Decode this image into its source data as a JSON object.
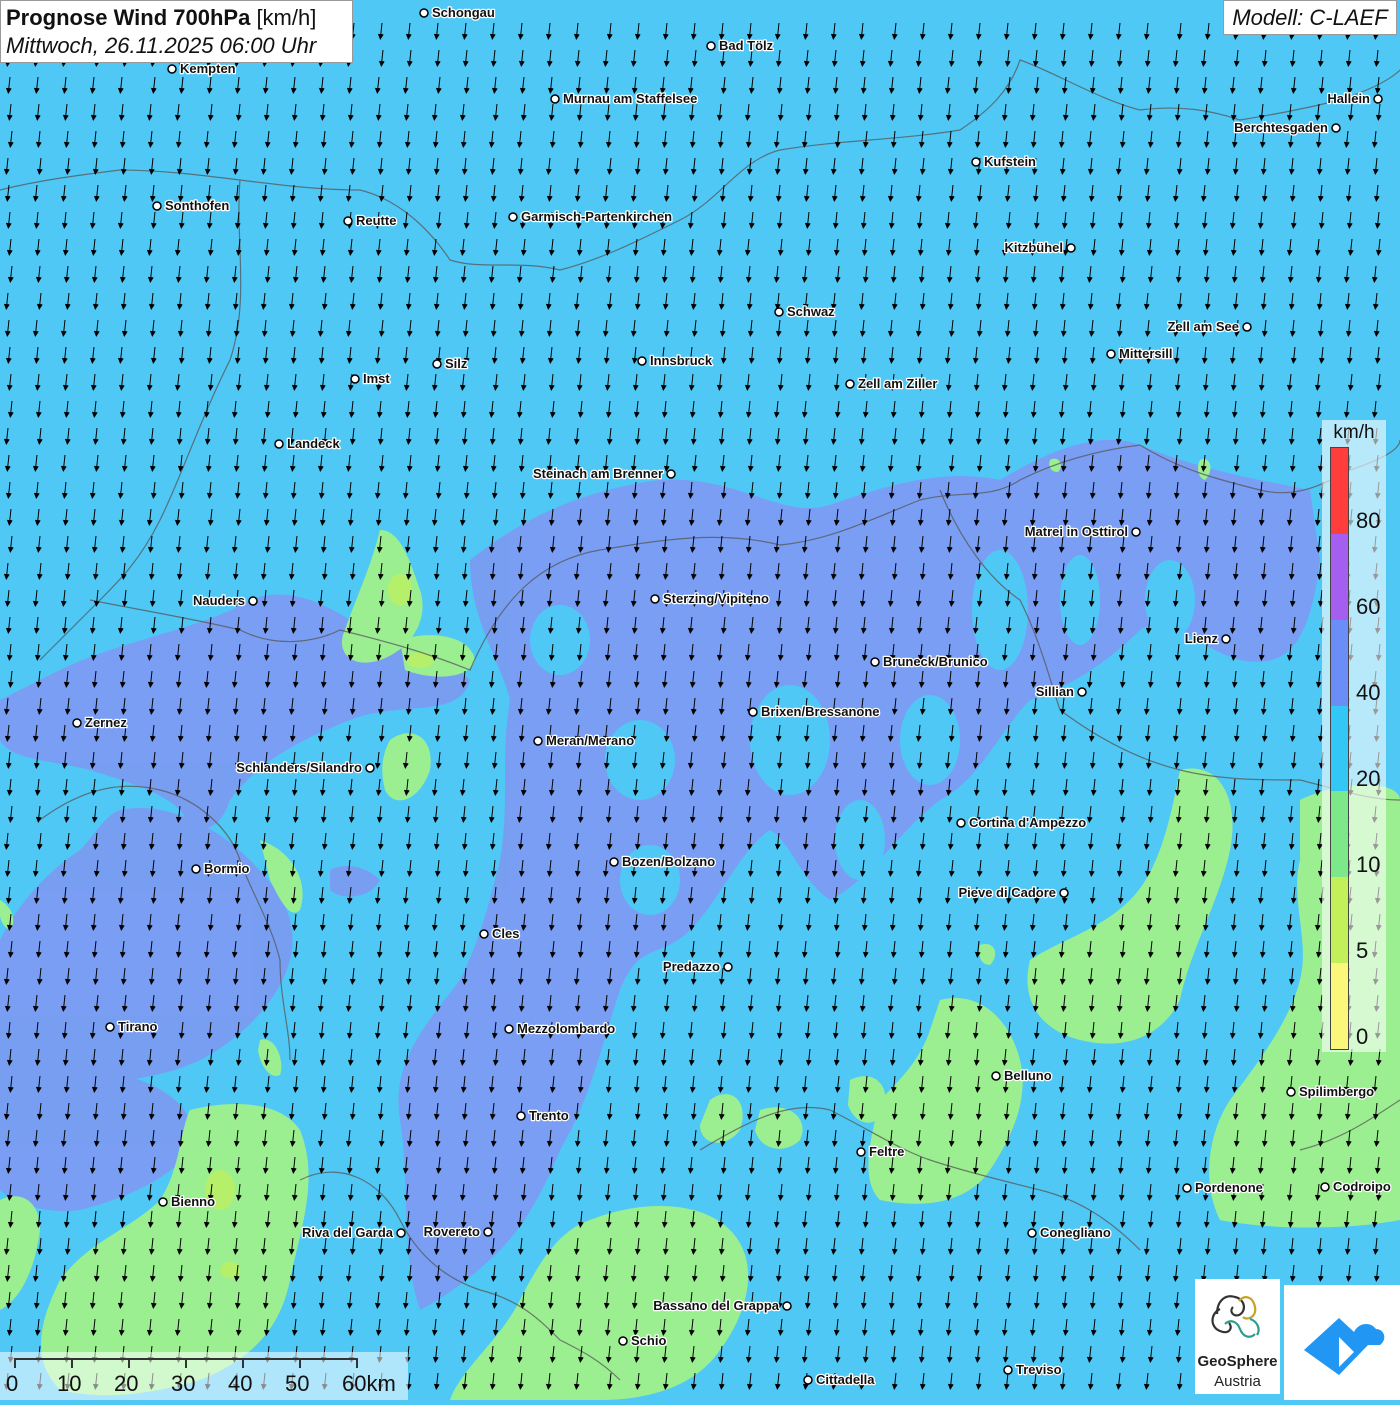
{
  "title": {
    "bold": "Prognose Wind 700hPa",
    "unit": "[km/h]",
    "date": "Mittwoch, 26.11.2025 06:00 Uhr"
  },
  "model": "Modell: C-LAEF",
  "legend": {
    "unit": "km/h",
    "ticks": [
      "80",
      "60",
      "40",
      "20",
      "10",
      "5",
      "0"
    ],
    "colors": [
      "#ff3d3d",
      "#a45ff0",
      "#6b8df7",
      "#33c7f5",
      "#7de88a",
      "#c2f059",
      "#fbf77a"
    ]
  },
  "scale": {
    "labels": [
      "0",
      "10",
      "20",
      "30",
      "40",
      "50",
      "60km"
    ]
  },
  "logo": {
    "name": "GeoSphere",
    "sub": "Austria"
  },
  "colors": {
    "background": "#4fc8f5",
    "zone_40_60": "#7b9cf2",
    "zone_5_20": "#9bef90"
  },
  "wind_direction": "from north (arrows pointing south-southwest)",
  "cities": [
    {
      "name": "Schongau"
    },
    {
      "name": "Bad Tölz"
    },
    {
      "name": "Kempten"
    },
    {
      "name": "Hallein"
    },
    {
      "name": "Murnau am Staffelsee"
    },
    {
      "name": "Berchtesgaden"
    },
    {
      "name": "Kufstein"
    },
    {
      "name": "Sonthofen"
    },
    {
      "name": "Reutte"
    },
    {
      "name": "Garmisch-Partenkirchen"
    },
    {
      "name": "Kitzbühel"
    },
    {
      "name": "Schwaz"
    },
    {
      "name": "Zell am See"
    },
    {
      "name": "Mittersill"
    },
    {
      "name": "Silz"
    },
    {
      "name": "Innsbruck"
    },
    {
      "name": "Imst"
    },
    {
      "name": "Zell am Ziller"
    },
    {
      "name": "Landeck"
    },
    {
      "name": "Steinach am Brenner"
    },
    {
      "name": "Matrei in Osttirol"
    },
    {
      "name": "Nauders"
    },
    {
      "name": "Sterzing/Vipiteno"
    },
    {
      "name": "Lienz"
    },
    {
      "name": "Bruneck/Brunico"
    },
    {
      "name": "Sillian"
    },
    {
      "name": "Brixen/Bressanone"
    },
    {
      "name": "Zernez"
    },
    {
      "name": "Meran/Merano"
    },
    {
      "name": "Schlanders/Silandro"
    },
    {
      "name": "Cortina d'Ampezzo"
    },
    {
      "name": "Bozen/Bolzano"
    },
    {
      "name": "Bormio"
    },
    {
      "name": "Pieve di Cadore"
    },
    {
      "name": "Cles"
    },
    {
      "name": "Predazzo"
    },
    {
      "name": "Tirano"
    },
    {
      "name": "Mezzolombardo"
    },
    {
      "name": "Belluno"
    },
    {
      "name": "Spilimbergo"
    },
    {
      "name": "Trento"
    },
    {
      "name": "Feltre"
    },
    {
      "name": "Pordenone"
    },
    {
      "name": "Codroipo"
    },
    {
      "name": "Bienno"
    },
    {
      "name": "Riva del Garda"
    },
    {
      "name": "Rovereto"
    },
    {
      "name": "Conegliano"
    },
    {
      "name": "Bassano del Grappa"
    },
    {
      "name": "Schio"
    },
    {
      "name": "Treviso"
    },
    {
      "name": "Cittadella"
    }
  ]
}
